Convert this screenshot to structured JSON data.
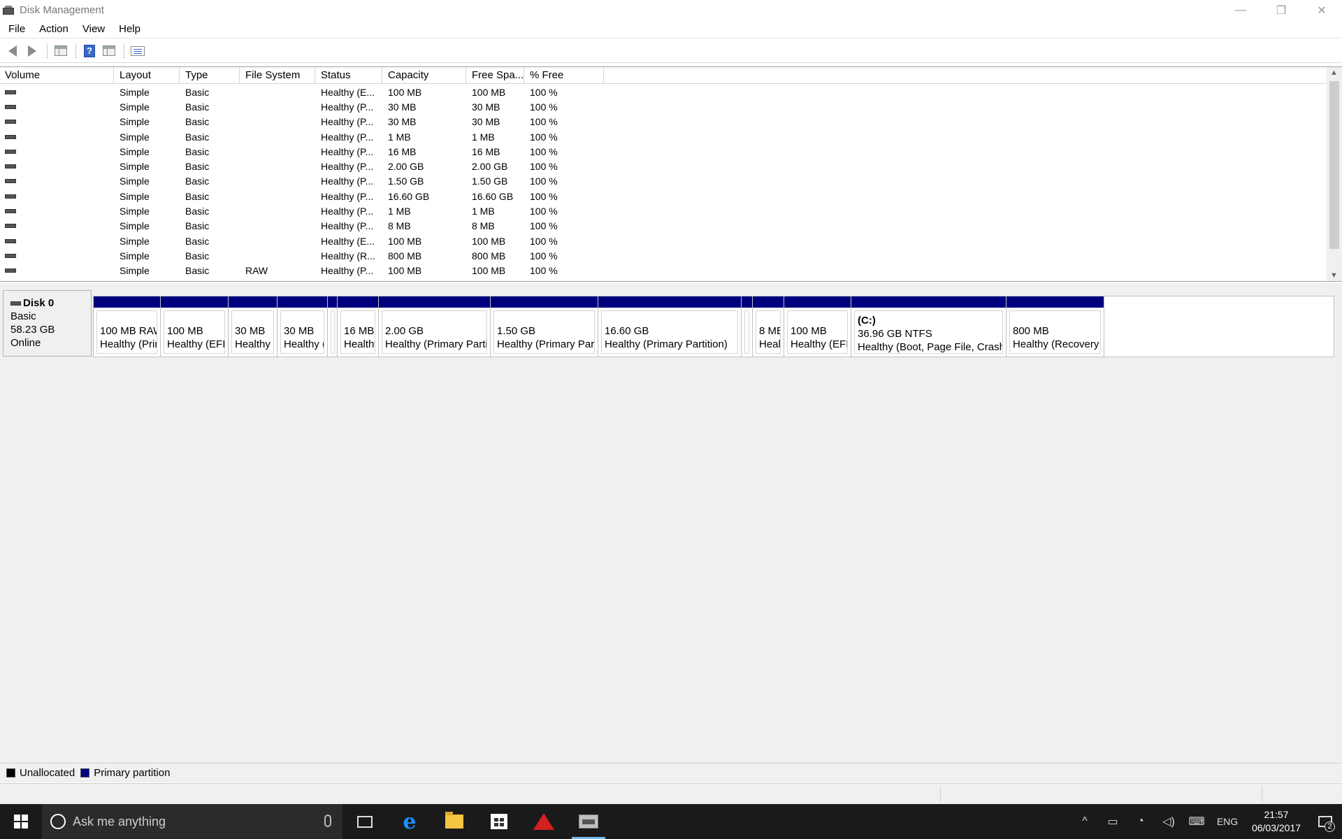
{
  "window": {
    "title": "Disk Management",
    "controls": {
      "minimize": "—",
      "restore": "❐",
      "close": "✕"
    }
  },
  "menu": [
    "File",
    "Action",
    "View",
    "Help"
  ],
  "toolbar": {
    "icons": [
      "back-icon",
      "forward-icon",
      "console-tree-icon",
      "help-icon",
      "show-hide-pane-icon",
      "properties-icon"
    ],
    "help_glyph": "?"
  },
  "volume_list": {
    "columns": [
      "Volume",
      "Layout",
      "Type",
      "File System",
      "Status",
      "Capacity",
      "Free Spa...",
      "% Free"
    ],
    "rows": [
      {
        "layout": "Simple",
        "type": "Basic",
        "fs": "",
        "status": "Healthy (E...",
        "capacity": "100 MB",
        "free": "100 MB",
        "pct": "100 %"
      },
      {
        "layout": "Simple",
        "type": "Basic",
        "fs": "",
        "status": "Healthy (P...",
        "capacity": "30 MB",
        "free": "30 MB",
        "pct": "100 %"
      },
      {
        "layout": "Simple",
        "type": "Basic",
        "fs": "",
        "status": "Healthy (P...",
        "capacity": "30 MB",
        "free": "30 MB",
        "pct": "100 %"
      },
      {
        "layout": "Simple",
        "type": "Basic",
        "fs": "",
        "status": "Healthy (P...",
        "capacity": "1 MB",
        "free": "1 MB",
        "pct": "100 %"
      },
      {
        "layout": "Simple",
        "type": "Basic",
        "fs": "",
        "status": "Healthy (P...",
        "capacity": "16 MB",
        "free": "16 MB",
        "pct": "100 %"
      },
      {
        "layout": "Simple",
        "type": "Basic",
        "fs": "",
        "status": "Healthy (P...",
        "capacity": "2.00 GB",
        "free": "2.00 GB",
        "pct": "100 %"
      },
      {
        "layout": "Simple",
        "type": "Basic",
        "fs": "",
        "status": "Healthy (P...",
        "capacity": "1.50 GB",
        "free": "1.50 GB",
        "pct": "100 %"
      },
      {
        "layout": "Simple",
        "type": "Basic",
        "fs": "",
        "status": "Healthy (P...",
        "capacity": "16.60 GB",
        "free": "16.60 GB",
        "pct": "100 %"
      },
      {
        "layout": "Simple",
        "type": "Basic",
        "fs": "",
        "status": "Healthy (P...",
        "capacity": "1 MB",
        "free": "1 MB",
        "pct": "100 %"
      },
      {
        "layout": "Simple",
        "type": "Basic",
        "fs": "",
        "status": "Healthy (P...",
        "capacity": "8 MB",
        "free": "8 MB",
        "pct": "100 %"
      },
      {
        "layout": "Simple",
        "type": "Basic",
        "fs": "",
        "status": "Healthy (E...",
        "capacity": "100 MB",
        "free": "100 MB",
        "pct": "100 %"
      },
      {
        "layout": "Simple",
        "type": "Basic",
        "fs": "",
        "status": "Healthy (R...",
        "capacity": "800 MB",
        "free": "800 MB",
        "pct": "100 %"
      },
      {
        "layout": "Simple",
        "type": "Basic",
        "fs": "RAW",
        "status": "Healthy (P...",
        "capacity": "100 MB",
        "free": "100 MB",
        "pct": "100 %"
      }
    ]
  },
  "disk": {
    "name": "Disk 0",
    "type": "Basic",
    "size": "58.23 GB",
    "state": "Online",
    "partitions": [
      {
        "title": "",
        "line1": "100 MB RAW",
        "line2": "Healthy (Prima"
      },
      {
        "title": "",
        "line1": "100 MB",
        "line2": "Healthy (EFI Sy"
      },
      {
        "title": "",
        "line1": "30 MB",
        "line2": "Healthy (P"
      },
      {
        "title": "",
        "line1": "30 MB",
        "line2": "Healthy (P"
      },
      {
        "title": "",
        "line1": "",
        "line2": ""
      },
      {
        "title": "",
        "line1": "16 MB",
        "line2": "Healthy"
      },
      {
        "title": "",
        "line1": "2.00 GB",
        "line2": "Healthy (Primary Partition)"
      },
      {
        "title": "",
        "line1": "1.50 GB",
        "line2": "Healthy (Primary Partition"
      },
      {
        "title": "",
        "line1": "16.60 GB",
        "line2": "Healthy (Primary Partition)"
      },
      {
        "title": "",
        "line1": "",
        "line2": ""
      },
      {
        "title": "",
        "line1": "8 MB",
        "line2": "Healt"
      },
      {
        "title": "",
        "line1": "100 MB",
        "line2": "Healthy (EFI Sy"
      },
      {
        "title": "(C:)",
        "line1": "36.96 GB NTFS",
        "line2": "Healthy (Boot, Page File, Crash Dump,"
      },
      {
        "title": "",
        "line1": "800 MB",
        "line2": "Healthy (Recovery Partit"
      }
    ]
  },
  "legend": [
    {
      "label": "Unallocated",
      "color": "#000000"
    },
    {
      "label": "Primary partition",
      "color": "#00007f"
    }
  ],
  "taskbar": {
    "search_placeholder": "Ask me anything",
    "apps": [
      "task-view-icon",
      "edge-icon",
      "file-explorer-icon",
      "store-icon",
      "red-triangle-app-icon",
      "disk-management-icon"
    ],
    "edge_glyph": "e",
    "tray": {
      "chevron": "^",
      "language": "ENG",
      "time": "21:57",
      "date": "06/03/2017",
      "notifications": "2"
    }
  }
}
